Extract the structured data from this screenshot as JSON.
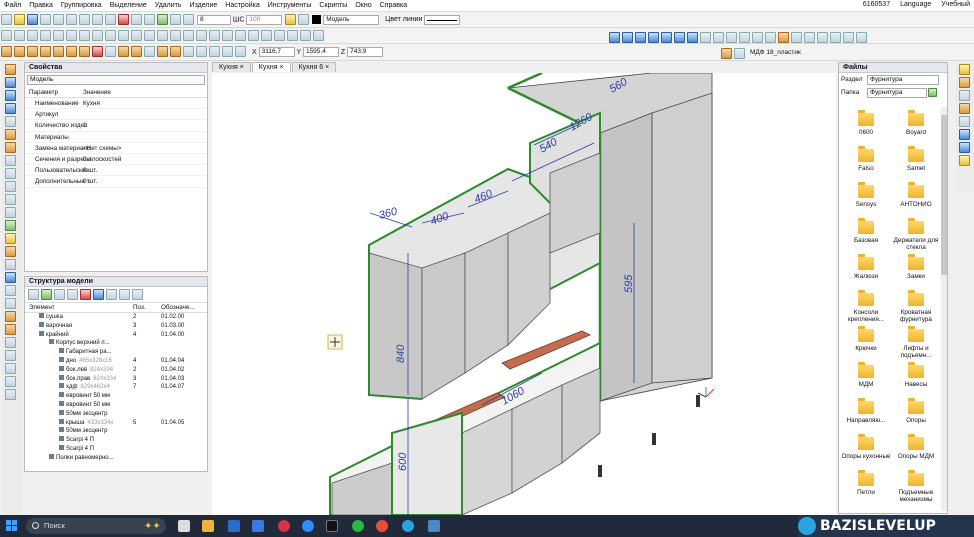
{
  "menu": {
    "items": [
      "Файл",
      "Правка",
      "Группировка",
      "Выделение",
      "Удалить",
      "Изделие",
      "Настройка",
      "Инструменты",
      "Скрипты",
      "Окно",
      "Справка"
    ],
    "right": [
      "6160537",
      "Language",
      "Учебный"
    ]
  },
  "toolbar": {
    "line_width": "8",
    "layer_label": "ШС",
    "layer_value": "100",
    "material": "Модель",
    "line_color_label": "Цвет линии",
    "coords": {
      "x_label": "X",
      "x": "3116,7",
      "y_label": "Y",
      "y": "1595,4",
      "z_label": "Z",
      "z": "743,9"
    },
    "current_material": "МДФ 18_пластик"
  },
  "properties": {
    "title": "Свойства",
    "object": "Модель",
    "col_param": "Параметр",
    "col_value": "Значение",
    "rows": [
      [
        "Наименование",
        "Кухня"
      ],
      [
        "Артикул",
        ""
      ],
      [
        "Количество издел",
        "1"
      ],
      [
        "Материалы",
        ""
      ],
      [
        "Замена материало",
        "<Нет схемы>"
      ],
      [
        "Сечения и разрезы",
        "0 плоскостей"
      ],
      [
        "Пользовательские",
        "0 шт."
      ],
      [
        "Дополнительные т",
        "0 шт."
      ]
    ]
  },
  "structure": {
    "title": "Структура модели",
    "col_element": "Элемент",
    "col_pos": "Поз.",
    "col_desig": "Обозначе...",
    "rows": [
      {
        "label": "сушка",
        "pos": "2",
        "desig": "01.02.00",
        "indent": 0
      },
      {
        "label": "варочная",
        "pos": "3",
        "desig": "01.03.00",
        "indent": 0
      },
      {
        "label": "крайний",
        "pos": "4",
        "desig": "01.04.00",
        "indent": 0
      },
      {
        "label": "Корпус верхний п...",
        "pos": "",
        "desig": "",
        "indent": 1
      },
      {
        "label": "Габаритная ра...",
        "pos": "",
        "desig": "",
        "indent": 2
      },
      {
        "label": "дно",
        "dim": "465x328x16",
        "pos": "4",
        "desig": "01.04.04",
        "indent": 2
      },
      {
        "label": "бок.лев",
        "dim": "824x334",
        "pos": "2",
        "desig": "01.04.02",
        "indent": 2
      },
      {
        "label": "бок.прав",
        "dim": "824x334",
        "pos": "3",
        "desig": "01.04.03",
        "indent": 2
      },
      {
        "label": "хдф",
        "dim": "829x462x4",
        "pos": "7",
        "desig": "01.04.07",
        "indent": 2
      },
      {
        "label": "евровинт 50 мм",
        "pos": "",
        "desig": "",
        "indent": 2
      },
      {
        "label": "евровинт 50 мм",
        "pos": "",
        "desig": "",
        "indent": 2
      },
      {
        "label": "50мм эксцентр",
        "pos": "",
        "desig": "",
        "indent": 2
      },
      {
        "label": "крыша",
        "dim": "433x334x",
        "pos": "5",
        "desig": "01.04.05",
        "indent": 2
      },
      {
        "label": "50мм эксцентр",
        "pos": "",
        "desig": "",
        "indent": 2
      },
      {
        "label": "Scarpi 4 П",
        "pos": "",
        "desig": "",
        "indent": 2
      },
      {
        "label": "Scarpi 4 П",
        "pos": "",
        "desig": "",
        "indent": 2
      },
      {
        "label": "Полки равномерно...",
        "pos": "",
        "desig": "",
        "indent": 1
      }
    ]
  },
  "tabs": [
    "Кухня",
    "Кухня",
    "Кухня 6"
  ],
  "dims": [
    "360",
    "400",
    "460",
    "1260",
    "560",
    "540",
    "840",
    "595",
    "600",
    "1060",
    "600"
  ],
  "files": {
    "title": "Файлы",
    "section_label": "Раздел",
    "section": "Фурнитура",
    "folder_label": "Папка",
    "folder": "Фурнитура",
    "items": [
      "0600",
      "Boyard",
      "Falso",
      "Samet",
      "Sensys",
      "АНТОНИО",
      "Базовая",
      "Держатели для стекла",
      "Жалюзи",
      "Замки",
      "Консоли крепления...",
      "Кроватная фурнитура",
      "Крючки",
      "Лифты и подъемн...",
      "МДМ",
      "Навесы",
      "Направляю...",
      "Опоры",
      "Опоры кухонные",
      "Опоры МДМ",
      "Петли",
      "Подъемные механизмы"
    ]
  },
  "taskbar": {
    "search": "Поиск",
    "brand": "BAZISLEVELUP"
  }
}
